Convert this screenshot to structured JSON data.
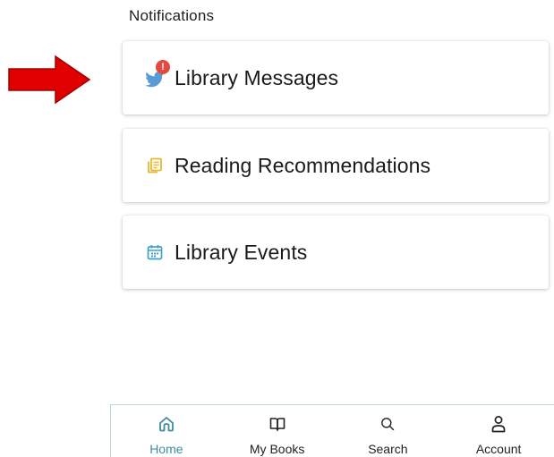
{
  "section": {
    "title": "Notifications"
  },
  "cards": [
    {
      "label": "Library Messages",
      "icon": "twitter-bird-icon",
      "badge": "!"
    },
    {
      "label": "Reading Recommendations",
      "icon": "stacked-pages-icon"
    },
    {
      "label": "Library Events",
      "icon": "calendar-icon"
    }
  ],
  "bottom_nav": {
    "items": [
      {
        "label": "Home",
        "icon": "home-icon",
        "active": true
      },
      {
        "label": "My Books",
        "icon": "open-book-icon",
        "active": false
      },
      {
        "label": "Search",
        "icon": "search-icon",
        "active": false
      },
      {
        "label": "Account",
        "icon": "person-icon",
        "active": false
      }
    ]
  },
  "colors": {
    "accent": "#3d8d9b",
    "annotation_arrow": "#e00000",
    "badge": "#e5483e",
    "twitter_icon": "#5a9bd5",
    "recommendations_icon": "#e8b931",
    "events_icon": "#3fa3c9"
  }
}
